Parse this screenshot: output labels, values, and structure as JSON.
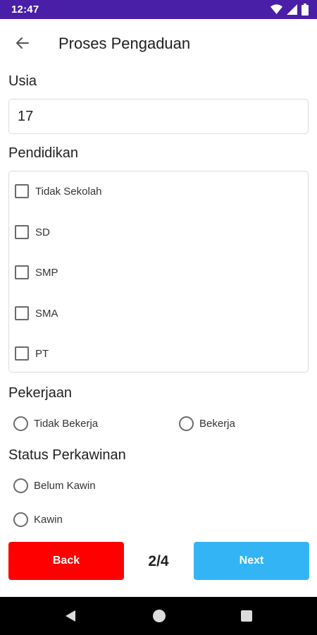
{
  "status_bar": {
    "time": "12:47"
  },
  "app_bar": {
    "title": "Proses Pengaduan"
  },
  "usia": {
    "label": "Usia",
    "value": "17"
  },
  "pendidikan": {
    "label": "Pendidikan",
    "options": [
      "Tidak Sekolah",
      "SD",
      "SMP",
      "SMA",
      "PT"
    ]
  },
  "pekerjaan": {
    "label": "Pekerjaan",
    "options": [
      "Tidak Bekerja",
      "Bekerja"
    ]
  },
  "status_perkawinan": {
    "label": "Status Perkawinan",
    "options": [
      "Belum Kawin",
      "Kawin"
    ]
  },
  "footer": {
    "back_label": "Back",
    "next_label": "Next",
    "page_indicator": "2/4"
  },
  "colors": {
    "status_bar": "#4a1fa8",
    "back_button": "#ff0000",
    "next_button": "#33b5f5"
  },
  "icons": [
    "back-arrow-icon",
    "wifi-icon",
    "signal-icon",
    "battery-icon",
    "nav-back-icon",
    "nav-home-icon",
    "nav-recents-icon"
  ]
}
